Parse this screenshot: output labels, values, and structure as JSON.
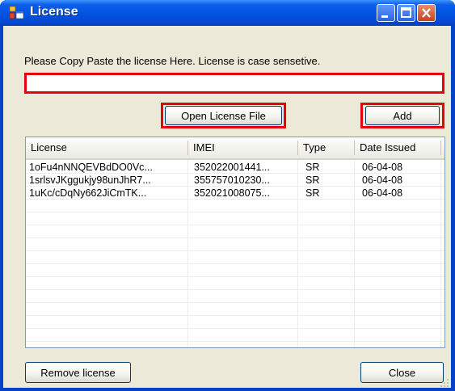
{
  "window": {
    "title": "License"
  },
  "instruction": "Please Copy Paste the license Here. License is case sensetive.",
  "license_input": {
    "value": ""
  },
  "buttons": {
    "open_file": "Open License File",
    "add": "Add",
    "remove": "Remove license",
    "close": "Close"
  },
  "table": {
    "columns": [
      "License",
      "IMEI",
      "Type",
      "Date Issued"
    ],
    "rows": [
      [
        "1oFu4nNNQEVBdDO0Vc...",
        "352022001441...",
        "SR",
        "06-04-08"
      ],
      [
        "1srlsvJKggukjy98unJhR7...",
        "355757010230...",
        "SR",
        "06-04-08"
      ],
      [
        "1uKc/cDqNy662JiCmTK...",
        "352021008075...",
        "SR",
        "06-04-08"
      ]
    ]
  },
  "colors": {
    "highlight": "#e8000b",
    "titlebar": "#0254e3",
    "face": "#ece9d8"
  }
}
